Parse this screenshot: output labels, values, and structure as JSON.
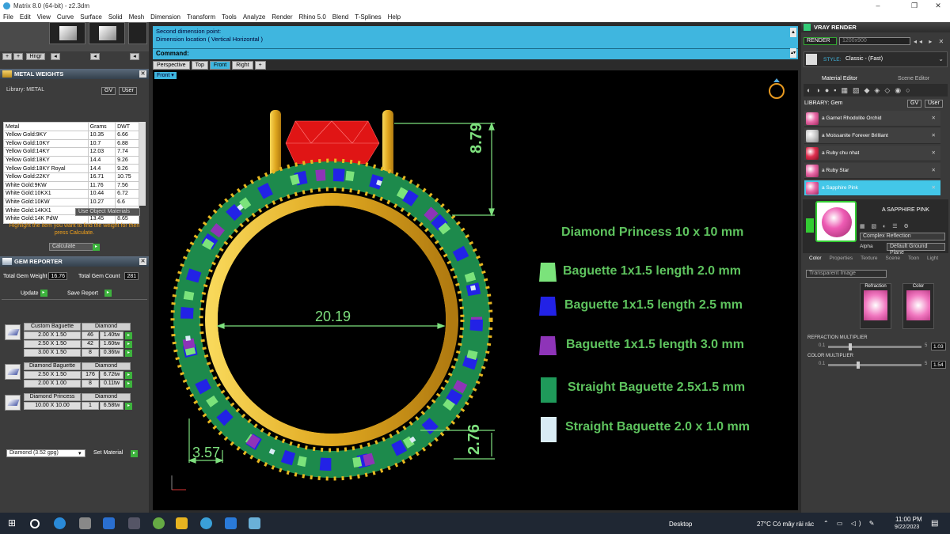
{
  "window": {
    "title": "Matrix 8.0 (64-bit) - z2.3dm"
  },
  "menu": [
    "File",
    "Edit",
    "View",
    "Curve",
    "Surface",
    "Solid",
    "Mesh",
    "Dimension",
    "Transform",
    "Tools",
    "Analyze",
    "Render",
    "Rhino 5.0",
    "Blend",
    "T-Splines",
    "Help"
  ],
  "metal_weights": {
    "header": "METAL WEIGHTS",
    "library_label": "Library: METAL",
    "columns": [
      "Metal",
      "Grams",
      "DWT"
    ],
    "rows": [
      [
        "Yellow Gold:9KY",
        "10.35",
        "6.66"
      ],
      [
        "Yellow Gold:10KY",
        "10.7",
        "6.88"
      ],
      [
        "Yellow Gold:14KY",
        "12.03",
        "7.74"
      ],
      [
        "Yellow Gold:18KY",
        "14.4",
        "9.26"
      ],
      [
        "Yellow Gold:18KY Royal",
        "14.4",
        "9.26"
      ],
      [
        "Yellow Gold:22KY",
        "16.71",
        "10.75"
      ],
      [
        "White Gold:9KW",
        "11.76",
        "7.56"
      ],
      [
        "White Gold:10KX1",
        "10.44",
        "6.72"
      ],
      [
        "White Gold:10KW",
        "10.27",
        "6.6"
      ],
      [
        "White Gold:14KX1",
        "11.78",
        "7.58"
      ],
      [
        "White Gold:14K PdW",
        "13.45",
        "8.65"
      ]
    ],
    "use_object_materials": "Use Object Materials",
    "hint": "Highlight the item you want to find the weight for then press Calculate.",
    "calculate": "Calculate"
  },
  "gem_reporter": {
    "header": "GEM REPORTER",
    "total_weight_label": "Total Gem Weight",
    "total_weight": "16.76",
    "total_count_label": "Total Gem Count",
    "total_count": "281",
    "update": "Update",
    "save_report": "Save Report",
    "groups": [
      {
        "name": "Custom Baguette",
        "type": "Diamond",
        "rows": [
          [
            "2.00 X 1.50",
            "46",
            "1.40tw"
          ],
          [
            "2.50 X 1.50",
            "42",
            "1.60tw"
          ],
          [
            "3.00 X 1.50",
            "8",
            "0.36tw"
          ]
        ]
      },
      {
        "name": "Diamond Baguette",
        "type": "Diamond",
        "rows": [
          [
            "2.50 X 1.50",
            "176",
            "6.72tw"
          ],
          [
            "2.00 X 1.00",
            "8",
            "0.11tw"
          ]
        ]
      },
      {
        "name": "Diamond Princess",
        "type": "Diamond",
        "rows": [
          [
            "10.00 X 10.00",
            "1",
            "6.58tw"
          ]
        ]
      }
    ],
    "material_select": "Diamond     (3.52 gpg)",
    "set_material": "Set Material"
  },
  "command": {
    "line1": "Second dimension point:",
    "line2": "Dimension location ( Vertical  Horizontal )",
    "prompt": "Command:"
  },
  "view_tabs": [
    "Perspective",
    "Top",
    "Front",
    "Right",
    "+"
  ],
  "active_view": "Front",
  "viewport": {
    "label": "Front",
    "dimensions": {
      "top_height": "8.79",
      "inner_diameter": "20.19",
      "side_width": "3.57",
      "bottom_height": "2.76"
    },
    "legend_title": "Diamond Princess 10 x 10 mm",
    "legend": [
      {
        "text": "Baguette 1x1.5 length 2.0 mm",
        "color": "#7be37b"
      },
      {
        "text": "Baguette 1x1.5 length 2.5 mm",
        "color": "#2222e6"
      },
      {
        "text": "Baguette 1x1.5 length 3.0 mm",
        "color": "#8e34b8"
      },
      {
        "text": "Straight Baguette 2.5x1.5 mm",
        "color": "#1f9a5a"
      },
      {
        "text": "Straight Baguette 2.0 x 1.0 mm",
        "color": "#d9ecf5"
      }
    ]
  },
  "vray": {
    "header": "VRAY RENDER",
    "render_btn": "RENDER",
    "resolution": "1200x900",
    "style_label": "STYLE:",
    "style_value": "Classic - (Fast)",
    "tabs": [
      "Material Editor",
      "Scene Editor"
    ],
    "library_label": "LIBRARY: Gem",
    "materials": [
      "a Garnet Rhodolite Orchid",
      "a Moissanite Forever Brilliant",
      "a Ruby chu nhat",
      "a Ruby Star",
      "a Sapphire Pink"
    ],
    "selected_material": "A SAPPHIRE PINK",
    "complex_reflection": "Complex Reflection",
    "alpha_label": "Alpha",
    "ground_plane": "Default Ground Plane",
    "sub_tabs": [
      "Color",
      "Properties",
      "Texture",
      "Scene",
      "Toon",
      "Light"
    ],
    "transparent_image": "Transparent Image",
    "refraction_label": "Refraction",
    "color_label": "Color",
    "refraction_multiplier_label": "REFRACTION MULTIPLIER",
    "refraction_range": [
      "0.1",
      "5"
    ],
    "refraction_multiplier": "1.03",
    "color_multiplier_label": "COLOR MULTIPLIER",
    "color_range": [
      "0.1",
      "5"
    ],
    "color_multiplier": "1.54"
  },
  "taskbar": {
    "desktop": "Desktop",
    "weather": "27°C  Có mây rải rác",
    "time": "11:00 PM",
    "date": "9/22/2023"
  },
  "colors": {
    "accent": "#3fb6df",
    "dimension": "#7ee07e",
    "gold": "#e8b820",
    "ruby": "#e01515"
  }
}
